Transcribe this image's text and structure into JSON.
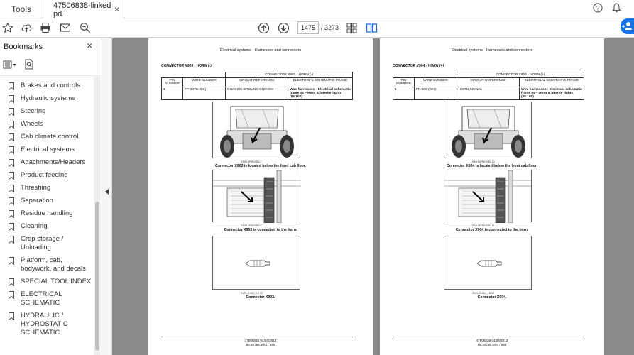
{
  "tabs": {
    "tools_label": "Tools",
    "doc_label": "47506838-linked pd...",
    "close_glyph": "×"
  },
  "toolbar": {
    "current_page": "1475",
    "total_pages": "/ 3273"
  },
  "sidebar": {
    "title": "Bookmarks",
    "close_glyph": "×",
    "items": [
      {
        "label": "Brakes and controls"
      },
      {
        "label": "Hydraulic systems"
      },
      {
        "label": "Steering"
      },
      {
        "label": "Wheels"
      },
      {
        "label": "Cab climate control"
      },
      {
        "label": "Electrical systems"
      },
      {
        "label": "Attachments/Headers"
      },
      {
        "label": "Product feeding"
      },
      {
        "label": "Threshing"
      },
      {
        "label": "Separation"
      },
      {
        "label": "Residue handling"
      },
      {
        "label": "Cleaning"
      },
      {
        "label": "Crop storage / Unloading"
      },
      {
        "label": "Platform, cab, bodywork, and decals"
      },
      {
        "label": "SPECIAL TOOL INDEX"
      },
      {
        "label": "ELECTRICAL SCHEMATIC"
      },
      {
        "label": "HYDRAULIC / HYDROSTATIC SCHEMATIC"
      }
    ]
  },
  "pages": {
    "left": {
      "header": "Electrical systems - Harnesses and connectors",
      "connector_title": "CONNECTOR X903 - HORN (-)",
      "table_title": "CONNECTOR X903 - HORN (-)",
      "col_pin": "PIN NUMBER",
      "col_wire": "WIRE NUMBER",
      "col_circuit": "CIRCUIT REFERENCE",
      "col_schematic": "ELECTRICAL SCHEMATIC FRAME",
      "row_pin": "1",
      "row_wire": "FP-307C (BK)",
      "row_circuit": "CHASSIS GROUND GND-004",
      "row_schematic": "Wire harnesses - Electrical schematic frame 04 – Horn & interior lights (55.100)",
      "fig1_code": "RAIL14PNK0384   7",
      "fig1_caption": "Connector X903 is located below the front cab floor.",
      "fig2_code": "RAIL16PNK0384   8",
      "fig2_caption": "Connector X903 is connected to the horn.",
      "fig3_code": "RAPLJ1H5D_1S   13",
      "fig3_caption": "Connector X903.",
      "footer1": "47506838 04/04/2013",
      "footer2": "55.10 [55.100] / 590"
    },
    "right": {
      "header": "Electrical systems - Harnesses and connectors",
      "connector_title": "CONNECTOR X904 - HORN (+)",
      "table_title": "CONNECTOR X904 - HORN (+)",
      "col_pin": "PIN NUMBER",
      "col_wire": "WIRE NUMBER",
      "col_circuit": "CIRCUIT REFERENCE",
      "col_schematic": "ELECTRICAL SCHEMATIC FRAME",
      "row_pin": "1",
      "row_wire": "FP-305 (WH)",
      "row_circuit": "HORN SIGNAL",
      "row_schematic": "Wire harnesses - Electrical schematic frame 04 – Horn & interior lights (55.100)",
      "fig1_code": "RAIL14PNK0384   10",
      "fig1_caption": "Connector X904 is located below the front cab floor.",
      "fig2_code": "RAIL16PNK0384   11",
      "fig2_caption": "Connector X904 is connected to the horn.",
      "fig3_code": "RAPLJ1H5D_1S   12",
      "fig3_caption": "Connector X904.",
      "footer1": "47506838 04/04/2013",
      "footer2": "55.10 [55.100] / 591"
    }
  },
  "colors": {
    "accent": "#1473e6",
    "doc_background": "#8a8a8a"
  }
}
